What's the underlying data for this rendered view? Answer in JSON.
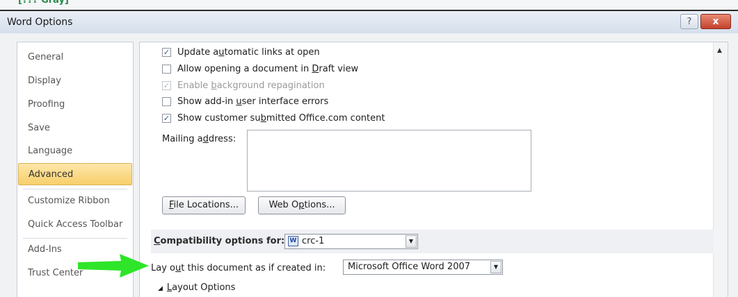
{
  "window": {
    "crop_text": "[??? Gray]",
    "title": "Word Options",
    "help_label": "?",
    "close_label": "x"
  },
  "sidebar": {
    "items": [
      {
        "label": "General",
        "selected": false
      },
      {
        "label": "Display",
        "selected": false
      },
      {
        "label": "Proofing",
        "selected": false
      },
      {
        "label": "Save",
        "selected": false
      },
      {
        "label": "Language",
        "selected": false
      },
      {
        "label": "Advanced",
        "selected": true
      },
      {
        "label": "Customize Ribbon",
        "selected": false
      },
      {
        "label": "Quick Access Toolbar",
        "selected": false
      },
      {
        "label": "Add-Ins",
        "selected": false
      },
      {
        "label": "Trust Center",
        "selected": false
      }
    ]
  },
  "options": [
    {
      "pre": "Update a",
      "key": "u",
      "post": "tomatic links at open",
      "checked": true,
      "disabled": false
    },
    {
      "pre": "Allow opening a document in ",
      "key": "D",
      "post": "raft view",
      "checked": false,
      "disabled": false
    },
    {
      "pre": "Enable ",
      "key": "b",
      "post": "ackground repagination",
      "checked": true,
      "disabled": true
    },
    {
      "pre": "Show add-in ",
      "key": "u",
      "post": "ser interface errors",
      "checked": false,
      "disabled": false
    },
    {
      "pre": "Show customer su",
      "key": "b",
      "post": "mitted Office.com content",
      "checked": true,
      "disabled": false
    }
  ],
  "mailing": {
    "pre": "Mailing a",
    "key": "d",
    "post": "dress:",
    "value": ""
  },
  "buttons": {
    "file_locations": {
      "pre": "",
      "key": "F",
      "post": "ile Locations..."
    },
    "web_options": {
      "pre": "Web O",
      "key": "p",
      "post": "tions..."
    }
  },
  "compat": {
    "label_key": "C",
    "label_post": "ompatibility options for:",
    "doc_name": "crc-1",
    "doc_icon": "word-document-icon",
    "layout_pre": "Lay o",
    "layout_key": "u",
    "layout_post": "t this document as if created in:",
    "layout_value": "Microsoft Office Word 2007",
    "layout_options_marker": "◢",
    "layout_options_key": "L",
    "layout_options_post": "ayout Options"
  },
  "annotation": {
    "arrow_color": "#2ee52a"
  }
}
